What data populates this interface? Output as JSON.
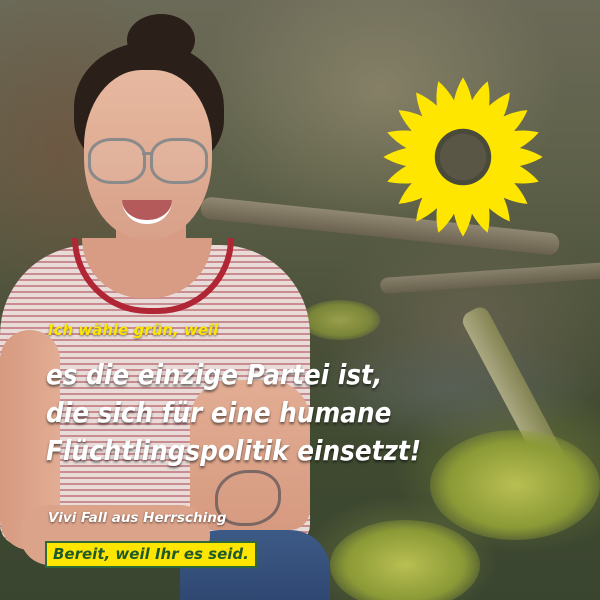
{
  "poster": {
    "kicker": "Ich wähle grün, weil",
    "headline_lines": [
      "es die einzige Partei ist,",
      "die sich für eine humane",
      "Flüchtlingspolitik einsetzt!"
    ],
    "byline": "Vivi Fall aus Herrsching",
    "slogan": "Bereit, weil Ihr es seid."
  },
  "colors": {
    "accent_yellow": "#ffe600",
    "slogan_green": "#1f5a2c",
    "sunflower_yellow": "#ffe600",
    "text_white": "#ffffff"
  },
  "icons": {
    "logo": "sunflower-icon"
  }
}
